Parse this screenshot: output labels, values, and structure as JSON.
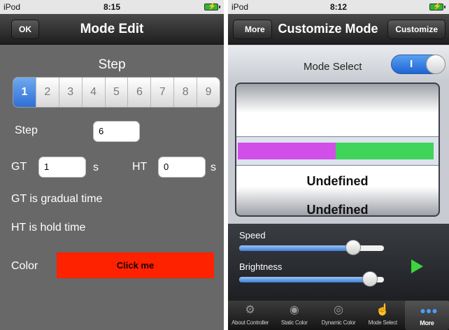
{
  "left": {
    "status": {
      "carrier": "iPod",
      "time": "8:15"
    },
    "nav": {
      "ok_label": "OK",
      "title": "Mode Edit"
    },
    "step_heading": "Step",
    "steps": [
      "1",
      "2",
      "3",
      "4",
      "5",
      "6",
      "7",
      "8",
      "9"
    ],
    "selected_step": "1",
    "step_label": "Step",
    "step_value": "6",
    "gt_label": "GT",
    "gt_value": "1",
    "gt_unit": "s",
    "ht_label": "HT",
    "ht_value": "0",
    "ht_unit": "s",
    "gt_note": "GT is gradual time",
    "ht_note": "HT is hold time",
    "color_label": "Color",
    "color_button": "Click me",
    "color_value": "#fe2200"
  },
  "right": {
    "status": {
      "carrier": "iPod",
      "time": "8:12"
    },
    "nav": {
      "back_label": "More",
      "title": "Customize Mode",
      "customize_label": "Customize"
    },
    "mode_select_label": "Mode Select",
    "toggle_text": "I",
    "toggle_on": true,
    "picker": {
      "swatches": [
        "#d24ee8",
        "#3fd45a"
      ],
      "rows": [
        "Undefined",
        "Undefined"
      ]
    },
    "speed_label": "Speed",
    "speed_level": 0.82,
    "brightness_label": "Brightness",
    "brightness_level": 0.95,
    "play_icon": "play-icon",
    "tabs": [
      {
        "label": "About Controller",
        "icon": "gear-icon"
      },
      {
        "label": "Static Color",
        "icon": "eye-icon"
      },
      {
        "label": "Dynamic Color",
        "icon": "eye-icon"
      },
      {
        "label": "Mode Select",
        "icon": "hand-icon"
      },
      {
        "label": "More",
        "icon": "more-icon"
      }
    ],
    "active_tab": "More"
  }
}
